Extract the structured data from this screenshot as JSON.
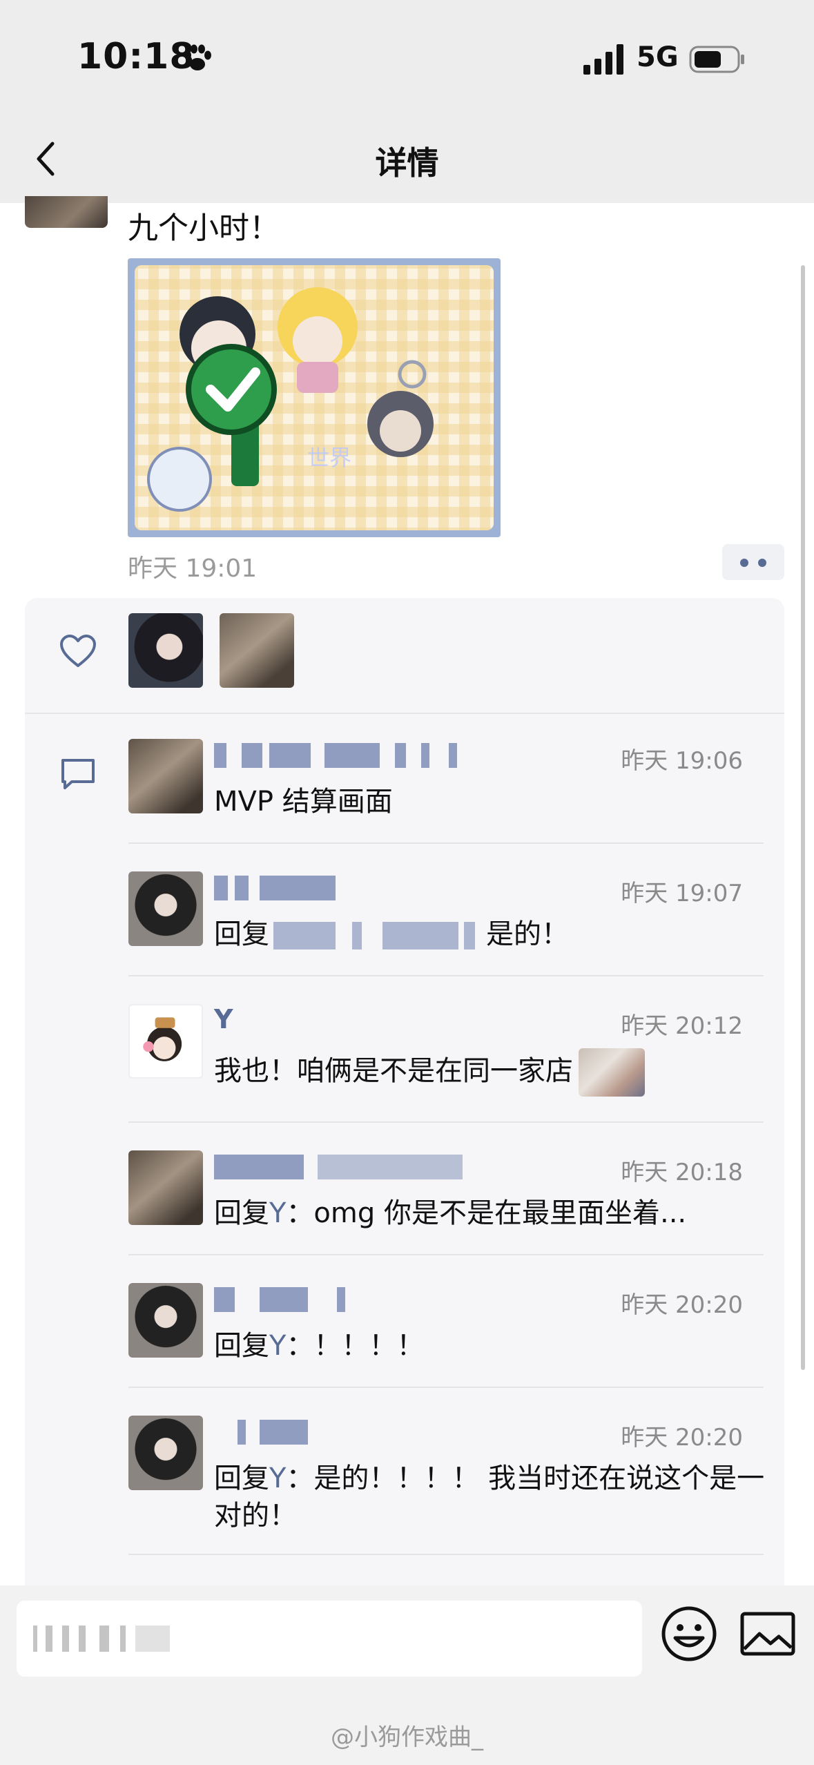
{
  "status_bar": {
    "time": "10:18",
    "network": "5G"
  },
  "nav": {
    "title": "详情"
  },
  "post": {
    "text": "九个小时！",
    "timestamp": "昨天 19:01"
  },
  "comments": [
    {
      "name": "",
      "time": "昨天 19:06",
      "text": "MVP 结算画面"
    },
    {
      "name": "",
      "time": "昨天 19:07",
      "reply_prefix": "回复",
      "text": "是的！"
    },
    {
      "name": "Y",
      "time": "昨天 20:12",
      "text": "我也！咱俩是不是在同一家店"
    },
    {
      "name": "",
      "time": "昨天 20:18",
      "reply_prefix": "回复",
      "reply_to": "Y",
      "text": "：omg 你是不是在最里面坐着..."
    },
    {
      "name": "",
      "time": "昨天 20:20",
      "reply_prefix": "回复",
      "reply_to": "Y",
      "text": "：！！！！"
    },
    {
      "name": "",
      "time": "昨天 20:20",
      "reply_prefix": "回复",
      "reply_to": "Y",
      "text": "：是的！！！！ 我当时还在说这个是一对的！"
    }
  ],
  "watermark": "@小狗作戏曲_",
  "icons": {
    "status": [
      "paw-icon",
      "signal-icon",
      "battery-icon"
    ],
    "nav": [
      "back-icon"
    ],
    "panel": [
      "heart-icon",
      "comment-icon"
    ],
    "input": [
      "emoji-icon",
      "image-icon"
    ]
  },
  "colors": {
    "link": "#576b95",
    "panel_bg": "#f6f6f8",
    "bar_bg": "#ededed"
  }
}
